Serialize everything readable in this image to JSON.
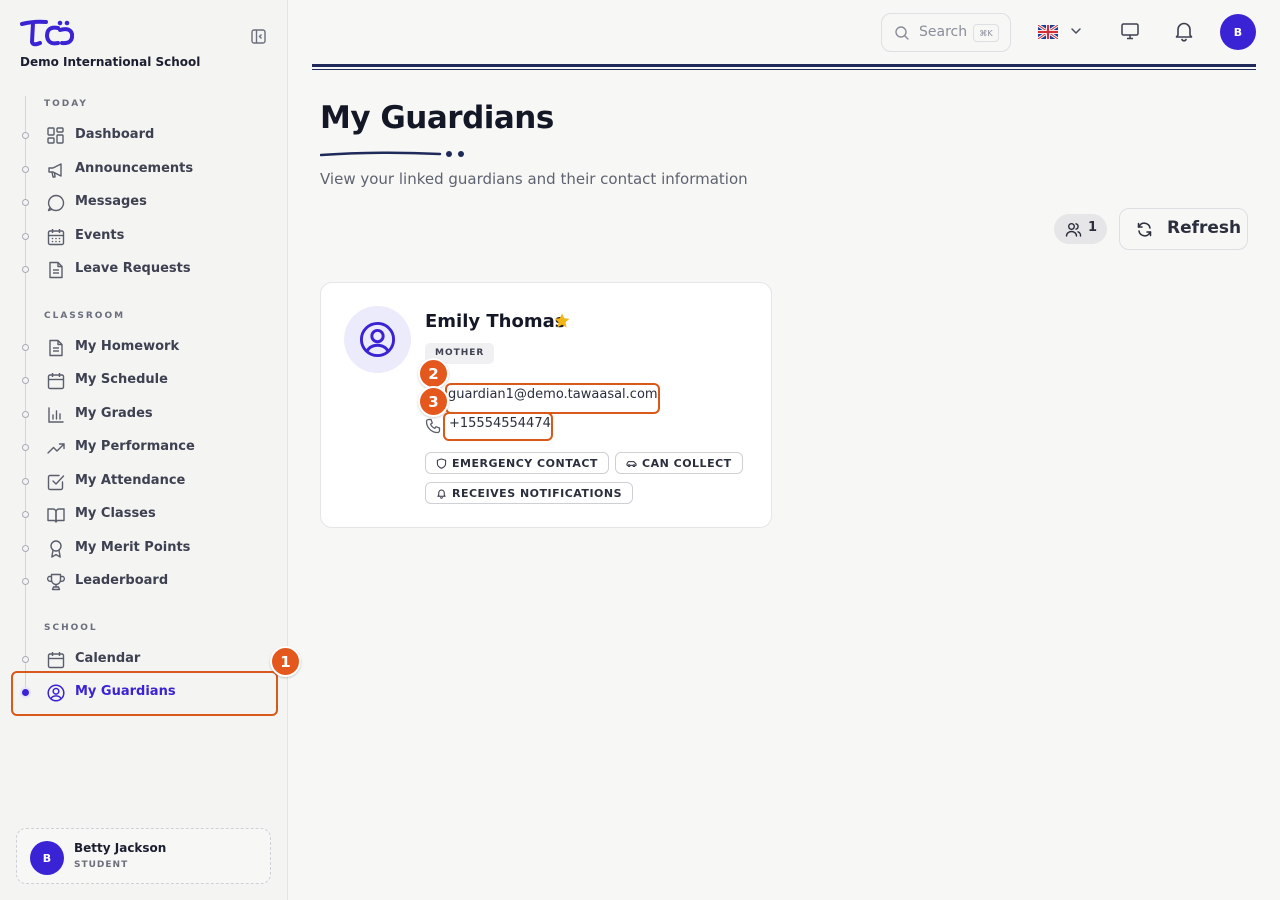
{
  "app": {
    "school_name": "Demo International School"
  },
  "sidebar": {
    "sections": [
      {
        "title": "TODAY",
        "items": [
          {
            "label": "Dashboard",
            "icon": "dashboard-icon"
          },
          {
            "label": "Announcements",
            "icon": "megaphone-icon"
          },
          {
            "label": "Messages",
            "icon": "message-icon"
          },
          {
            "label": "Events",
            "icon": "calendar-grid-icon"
          },
          {
            "label": "Leave Requests",
            "icon": "document-icon"
          }
        ]
      },
      {
        "title": "CLASSROOM",
        "items": [
          {
            "label": "My Homework",
            "icon": "document-icon"
          },
          {
            "label": "My Schedule",
            "icon": "calendar-icon"
          },
          {
            "label": "My Grades",
            "icon": "bar-chart-icon"
          },
          {
            "label": "My Performance",
            "icon": "trending-up-icon"
          },
          {
            "label": "My Attendance",
            "icon": "checkbox-icon"
          },
          {
            "label": "My Classes",
            "icon": "book-icon"
          },
          {
            "label": "My Merit Points",
            "icon": "award-icon"
          },
          {
            "label": "Leaderboard",
            "icon": "trophy-icon"
          }
        ]
      },
      {
        "title": "SCHOOL",
        "items": [
          {
            "label": "Calendar",
            "icon": "calendar-icon"
          },
          {
            "label": "My Guardians",
            "icon": "user-circle-icon",
            "active": true
          }
        ]
      }
    ],
    "user": {
      "initial": "B",
      "name": "Betty Jackson",
      "role": "STUDENT"
    }
  },
  "header": {
    "search_placeholder": "Search",
    "search_shortcut": "⌘K",
    "language_flag": "uk-flag-icon",
    "avatar_initial": "B"
  },
  "main": {
    "title": "My Guardians",
    "subtitle": "View your linked guardians and their contact information",
    "guardian_count": "1",
    "refresh_label": "Refresh",
    "guardians": [
      {
        "name": "Emily Thomas",
        "primary": true,
        "relation": "MOTHER",
        "email": "guardian1@demo.tawaasal.com",
        "phone": "+15554554474",
        "tags": [
          "EMERGENCY CONTACT",
          "CAN COLLECT",
          "RECEIVES NOTIFICATIONS"
        ]
      }
    ]
  },
  "annotations": {
    "markers": [
      "1",
      "2",
      "3"
    ]
  },
  "colors": {
    "accent": "#3a23d4",
    "annotation": "#e4581d",
    "star": "#f2b518",
    "divider": "#1f2a5a"
  }
}
